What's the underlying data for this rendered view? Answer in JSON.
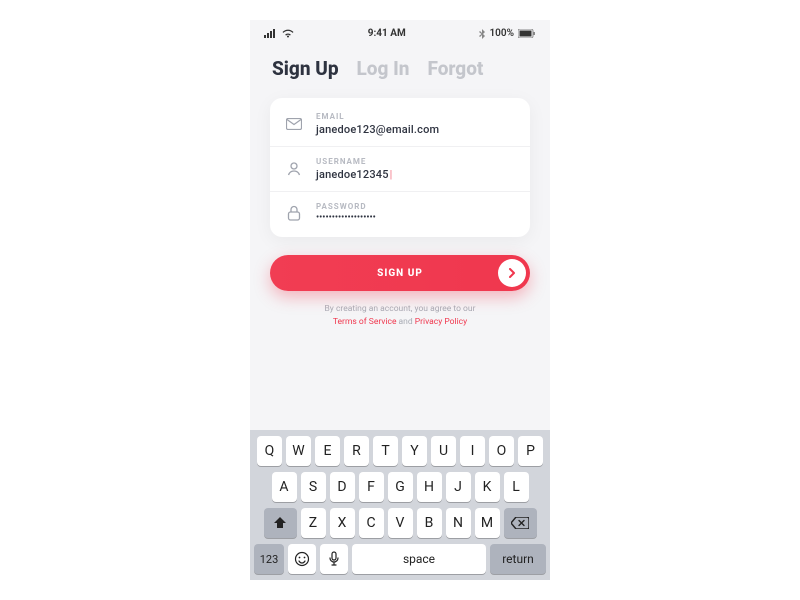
{
  "statusbar": {
    "time": "9:41 AM",
    "battery": "100%"
  },
  "tabs": {
    "signup": "Sign Up",
    "login": "Log In",
    "forgot": "Forgot"
  },
  "form": {
    "email_label": "EMAIL",
    "email_value": "janedoe123@email.com",
    "username_label": "USERNAME",
    "username_value": "janedoe12345",
    "password_label": "PASSWORD",
    "password_value": "•••••••••••••••••••"
  },
  "cta": {
    "label": "SIGN UP"
  },
  "legal": {
    "prefix": "By creating an account, you agree to our",
    "terms": "Terms of Service",
    "and": " and ",
    "privacy": "Privacy Policy"
  },
  "keyboard": {
    "row1": [
      "Q",
      "W",
      "E",
      "R",
      "T",
      "Y",
      "U",
      "I",
      "O",
      "P"
    ],
    "row2": [
      "A",
      "S",
      "D",
      "F",
      "G",
      "H",
      "J",
      "K",
      "L"
    ],
    "row3": [
      "Z",
      "X",
      "C",
      "V",
      "B",
      "N",
      "M"
    ],
    "numkey": "123",
    "space": "space",
    "return": "return"
  }
}
